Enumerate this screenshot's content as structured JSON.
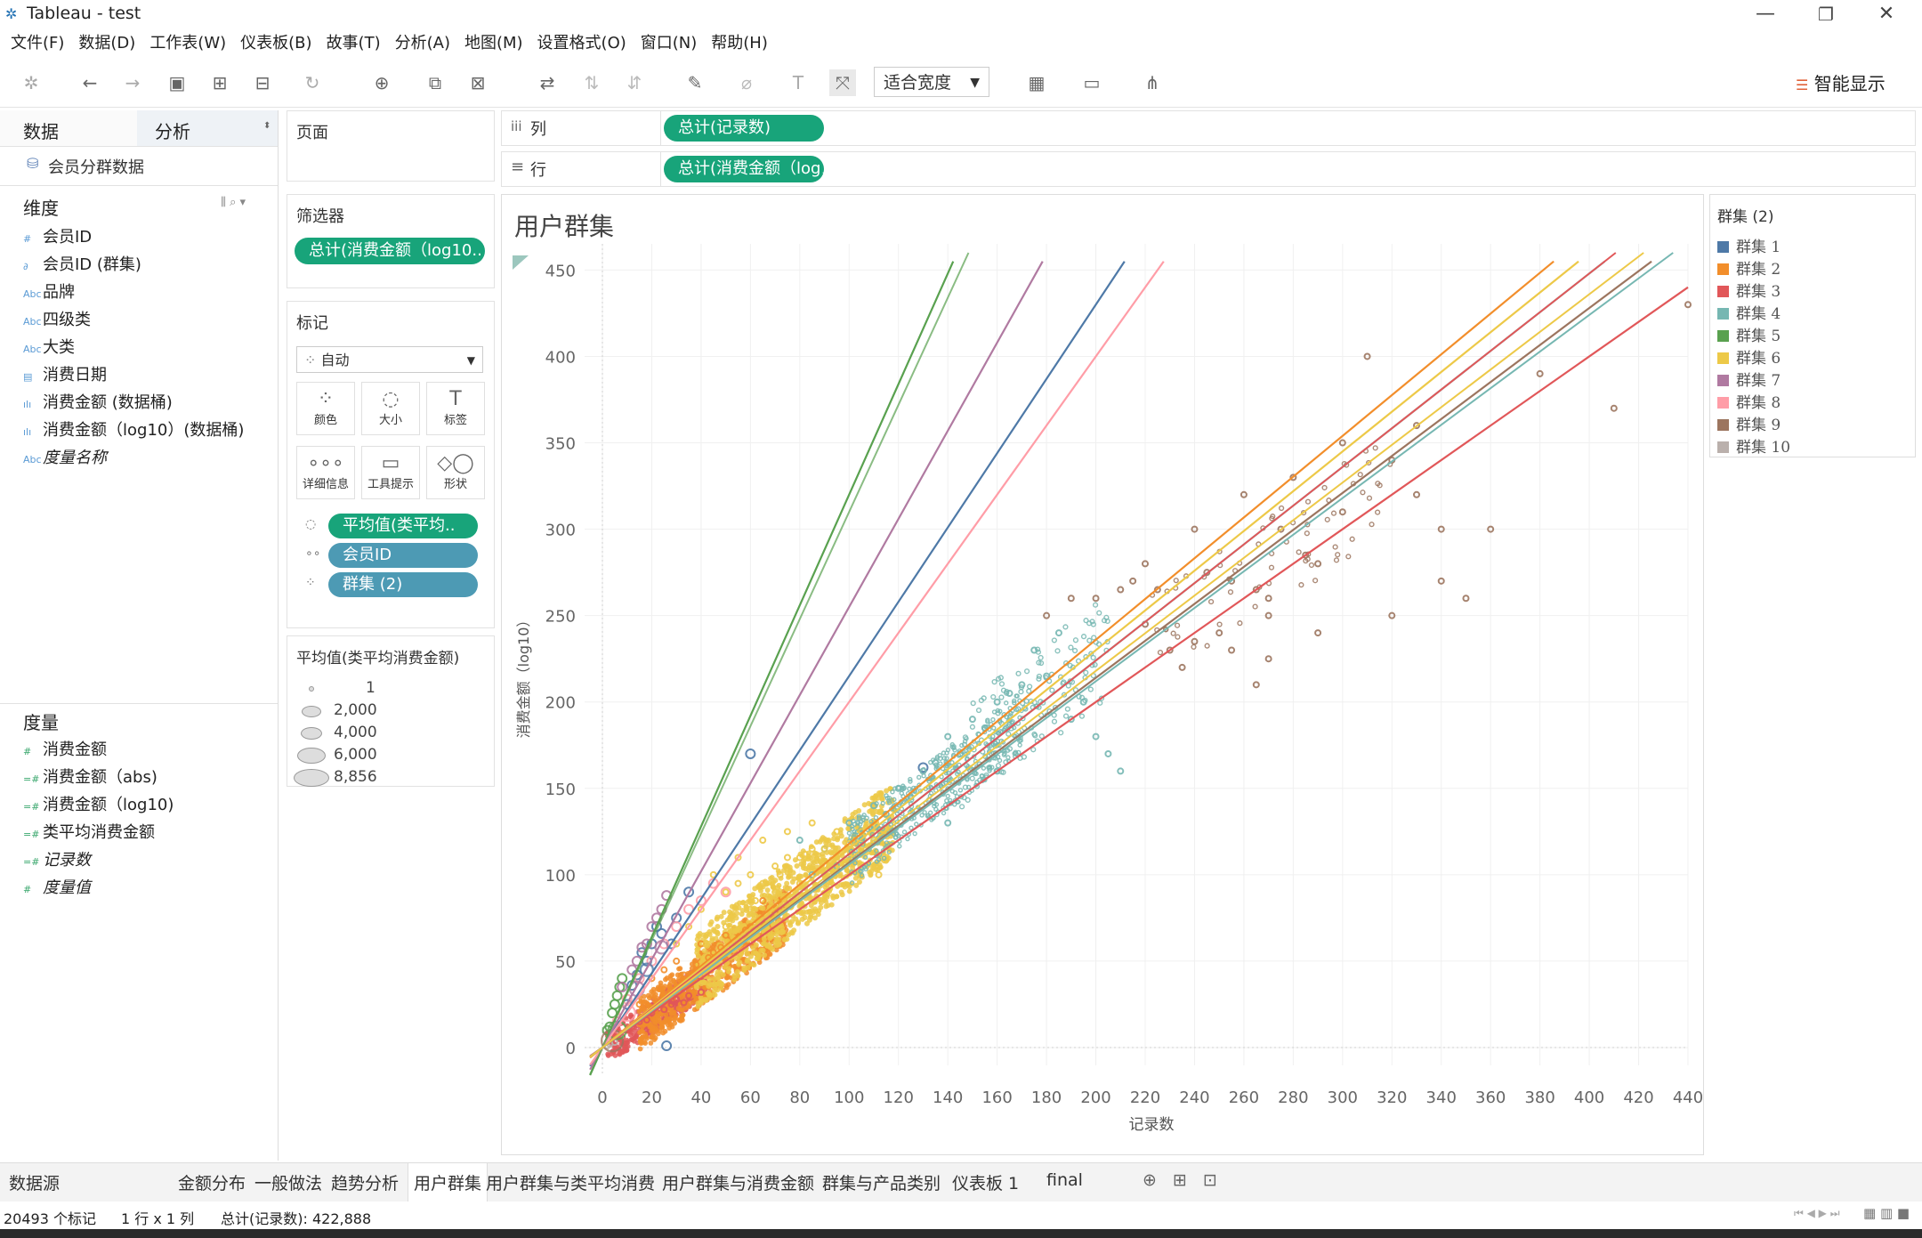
{
  "window": {
    "title": "Tableau - test",
    "min": "—",
    "max": "❐",
    "close": "✕"
  },
  "menu": [
    "文件(F)",
    "数据(D)",
    "工作表(W)",
    "仪表板(B)",
    "故事(T)",
    "分析(A)",
    "地图(M)",
    "设置格式(O)",
    "窗口(N)",
    "帮助(H)"
  ],
  "toolbar": {
    "fit": "适合宽度",
    "show_me": "智能显示"
  },
  "data_pane": {
    "tab_data": "数据",
    "tab_analysis": "分析",
    "datasource": "会员分群数据",
    "dimensions_title": "维度",
    "dimensions": [
      {
        "icon": "#",
        "label": "会员ID"
      },
      {
        "icon": "∂",
        "label": "会员ID (群集)"
      },
      {
        "icon": "Abc",
        "label": "品牌"
      },
      {
        "icon": "Abc",
        "label": "四级类"
      },
      {
        "icon": "Abc",
        "label": "大类"
      },
      {
        "icon": "▤",
        "label": "消费日期"
      },
      {
        "icon": "ılı",
        "label": "消费金额 (数据桶)"
      },
      {
        "icon": "ılı",
        "label": "消费金额（log10）(数据桶)"
      },
      {
        "icon": "Abc",
        "label": "度量名称"
      }
    ],
    "measures_title": "度量",
    "measures": [
      {
        "icon": "#",
        "label": "消费金额"
      },
      {
        "icon": "=#",
        "label": "消费金额（abs)"
      },
      {
        "icon": "=#",
        "label": "消费金额（log10)"
      },
      {
        "icon": "=#",
        "label": "类平均消费金额"
      },
      {
        "icon": "=#",
        "label": "记录数"
      },
      {
        "icon": "#",
        "label": "度量值"
      }
    ]
  },
  "pages": {
    "title": "页面"
  },
  "filters": {
    "title": "筛选器",
    "pill": "总计(消费金额（log10.."
  },
  "marks": {
    "title": "标记",
    "type": "自动",
    "buttons": [
      {
        "glyph": "⁘",
        "label": "颜色"
      },
      {
        "glyph": "◌",
        "label": "大小"
      },
      {
        "glyph": "T",
        "label": "标签"
      },
      {
        "glyph": "∘∘∘",
        "label": "详细信息"
      },
      {
        "glyph": "▭",
        "label": "工具提示"
      },
      {
        "glyph": "◇◯",
        "label": "形状"
      }
    ],
    "pills": [
      "平均值(类平均..",
      "会员ID",
      "群集 (2)"
    ]
  },
  "size_legend": {
    "title": "平均值(类平均消费金额)",
    "items": [
      "1",
      "2,000",
      "4,000",
      "6,000",
      "8,856"
    ]
  },
  "shelves": {
    "columns_label": "列",
    "columns_pill": "总计(记录数)",
    "rows_label": "行",
    "rows_pill": "总计(消费金额（log1.."
  },
  "chart_data": {
    "type": "scatter",
    "title": "用户群集",
    "xlabel": "记录数",
    "ylabel": "消费金额（log10）",
    "xlim": [
      0,
      440
    ],
    "ylim": [
      0,
      460
    ],
    "x_ticks": [
      "0",
      "20",
      "40",
      "60",
      "80",
      "100",
      "120",
      "140",
      "160",
      "180",
      "200",
      "220",
      "240",
      "260",
      "280",
      "300",
      "320",
      "340",
      "360",
      "380",
      "400",
      "420",
      "440"
    ],
    "y_ticks": [
      "0",
      "50",
      "100",
      "150",
      "200",
      "250",
      "300",
      "350",
      "400",
      "450"
    ],
    "legend_title": "群集 (2)",
    "series": [
      {
        "name": "群集 1",
        "color": "#4e79a7",
        "trend_slope": 2.15,
        "pts": [
          [
            26,
            1
          ],
          [
            130,
            162
          ],
          [
            60,
            170
          ],
          [
            20,
            60
          ],
          [
            14,
            42
          ],
          [
            12,
            36
          ],
          [
            18,
            50
          ],
          [
            22,
            70
          ],
          [
            16,
            55
          ],
          [
            30,
            75
          ],
          [
            10,
            25
          ],
          [
            24,
            66
          ],
          [
            35,
            90
          ],
          [
            28,
            60
          ]
        ]
      },
      {
        "name": "群集 2",
        "color": "#f28e2b",
        "trend_slope": 1.18,
        "pts": [
          [
            20,
            40
          ],
          [
            30,
            50
          ],
          [
            40,
            60
          ],
          [
            50,
            65
          ],
          [
            60,
            70
          ],
          [
            25,
            45
          ],
          [
            35,
            35
          ],
          [
            45,
            55
          ],
          [
            55,
            62
          ],
          [
            15,
            25
          ],
          [
            65,
            85
          ],
          [
            70,
            78
          ],
          [
            28,
            32
          ],
          [
            38,
            48
          ],
          [
            48,
            58
          ],
          [
            58,
            68
          ],
          [
            33,
            42
          ],
          [
            43,
            52
          ]
        ]
      },
      {
        "name": "群集 3",
        "color": "#e15759",
        "trend_slope": 1.0,
        "pts": [
          [
            10,
            10
          ],
          [
            15,
            15
          ],
          [
            20,
            20
          ],
          [
            25,
            22
          ],
          [
            30,
            28
          ],
          [
            35,
            30
          ],
          [
            40,
            32
          ],
          [
            12,
            12
          ],
          [
            18,
            16
          ],
          [
            22,
            24
          ],
          [
            28,
            25
          ],
          [
            33,
            26
          ],
          [
            8,
            6
          ],
          [
            5,
            4
          ]
        ]
      },
      {
        "name": "群集 4",
        "color": "#76b7b2",
        "trend_slope": 1.12,
        "pts": [
          [
            100,
            130
          ],
          [
            110,
            140
          ],
          [
            120,
            150
          ],
          [
            130,
            160
          ],
          [
            140,
            180
          ],
          [
            150,
            190
          ],
          [
            160,
            200
          ],
          [
            170,
            210
          ],
          [
            180,
            215
          ],
          [
            190,
            190
          ],
          [
            200,
            180
          ],
          [
            210,
            160
          ],
          [
            125,
            145
          ],
          [
            135,
            165
          ],
          [
            145,
            170
          ],
          [
            155,
            185
          ],
          [
            165,
            205
          ],
          [
            175,
            230
          ],
          [
            185,
            240
          ],
          [
            105,
            120
          ],
          [
            115,
            135
          ],
          [
            95,
            105
          ],
          [
            90,
            115
          ],
          [
            85,
            100
          ],
          [
            80,
            120
          ],
          [
            195,
            200
          ],
          [
            205,
            170
          ],
          [
            140,
            130
          ],
          [
            160,
            160
          ]
        ]
      },
      {
        "name": "群集 5",
        "color": "#59a14f",
        "trend_slope": 3.2,
        "pts": [
          [
            2,
            10
          ],
          [
            4,
            20
          ],
          [
            6,
            30
          ],
          [
            8,
            40
          ],
          [
            3,
            12
          ],
          [
            5,
            25
          ],
          [
            7,
            35
          ]
        ]
      },
      {
        "name": "群集 6",
        "color": "#edc948",
        "trend_slope": 1.15,
        "pts": [
          [
            40,
            80
          ],
          [
            50,
            90
          ],
          [
            60,
            100
          ],
          [
            70,
            105
          ],
          [
            80,
            110
          ],
          [
            90,
            115
          ],
          [
            100,
            118
          ],
          [
            110,
            120
          ],
          [
            45,
            100
          ],
          [
            55,
            110
          ],
          [
            65,
            120
          ],
          [
            75,
            125
          ],
          [
            85,
            130
          ],
          [
            95,
            125
          ],
          [
            105,
            125
          ],
          [
            35,
            70
          ],
          [
            30,
            60
          ],
          [
            50,
            70
          ],
          [
            60,
            80
          ],
          [
            70,
            90
          ],
          [
            80,
            95
          ],
          [
            90,
            100
          ],
          [
            100,
            108
          ],
          [
            42,
            60
          ],
          [
            52,
            75
          ],
          [
            62,
            85
          ],
          [
            72,
            100
          ],
          [
            82,
            112
          ],
          [
            92,
            105
          ],
          [
            112,
            100
          ],
          [
            55,
            95
          ],
          [
            65,
            95
          ],
          [
            75,
            110
          ],
          [
            85,
            115
          ],
          [
            95,
            110
          ]
        ]
      },
      {
        "name": "群集 7",
        "color": "#b07aa1",
        "trend_slope": 2.55,
        "pts": [
          [
            8,
            35
          ],
          [
            12,
            45
          ],
          [
            16,
            58
          ],
          [
            20,
            70
          ],
          [
            24,
            80
          ],
          [
            14,
            50
          ],
          [
            18,
            60
          ],
          [
            22,
            75
          ],
          [
            26,
            88
          ]
        ]
      },
      {
        "name": "群集 8",
        "color": "#ff9da7",
        "trend_slope": 2.0,
        "pts": [
          [
            20,
            50
          ],
          [
            25,
            60
          ],
          [
            30,
            70
          ],
          [
            40,
            85
          ],
          [
            50,
            90
          ],
          [
            15,
            40
          ],
          [
            35,
            80
          ],
          [
            45,
            95
          ],
          [
            6,
            15
          ],
          [
            10,
            28
          ]
        ]
      },
      {
        "name": "群集 9",
        "color": "#9c755f",
        "trend_slope": 1.07,
        "pts": [
          [
            180,
            250
          ],
          [
            200,
            260
          ],
          [
            220,
            280
          ],
          [
            240,
            300
          ],
          [
            260,
            320
          ],
          [
            280,
            330
          ],
          [
            300,
            350
          ],
          [
            310,
            400
          ],
          [
            330,
            320
          ],
          [
            340,
            300
          ],
          [
            350,
            260
          ],
          [
            380,
            390
          ],
          [
            410,
            370
          ],
          [
            440,
            430
          ],
          [
            230,
            230
          ],
          [
            250,
            240
          ],
          [
            270,
            260
          ],
          [
            290,
            280
          ],
          [
            300,
            310
          ],
          [
            320,
            340
          ],
          [
            330,
            360
          ],
          [
            360,
            300
          ],
          [
            270,
            250
          ],
          [
            290,
            240
          ],
          [
            320,
            250
          ],
          [
            340,
            270
          ],
          [
            215,
            270
          ],
          [
            225,
            265
          ],
          [
            245,
            275
          ],
          [
            255,
            270
          ],
          [
            265,
            265
          ],
          [
            275,
            300
          ],
          [
            285,
            285
          ],
          [
            265,
            210
          ],
          [
            270,
            225
          ],
          [
            255,
            230
          ],
          [
            240,
            235
          ],
          [
            235,
            220
          ],
          [
            220,
            245
          ],
          [
            210,
            265
          ],
          [
            190,
            260
          ]
        ]
      },
      {
        "name": "群集 10",
        "color": "#bab0ac",
        "trend_slope": 1.2,
        "pts": [
          [
            3,
            2
          ],
          [
            5,
            3
          ],
          [
            2,
            1
          ]
        ]
      }
    ]
  },
  "sheet_tabs": [
    "数据源",
    "金额分布",
    "一般做法",
    "趋势分析",
    "用户群集",
    "用户群集与类平均消费",
    "用户群集与消费金额",
    "群集与产品类别",
    "仪表板 1",
    "final"
  ],
  "active_tab": "用户群集",
  "status": {
    "marks": "20493 个标记",
    "grid": "1 行 x 1 列",
    "sum": "总计(记录数): 422,888"
  }
}
